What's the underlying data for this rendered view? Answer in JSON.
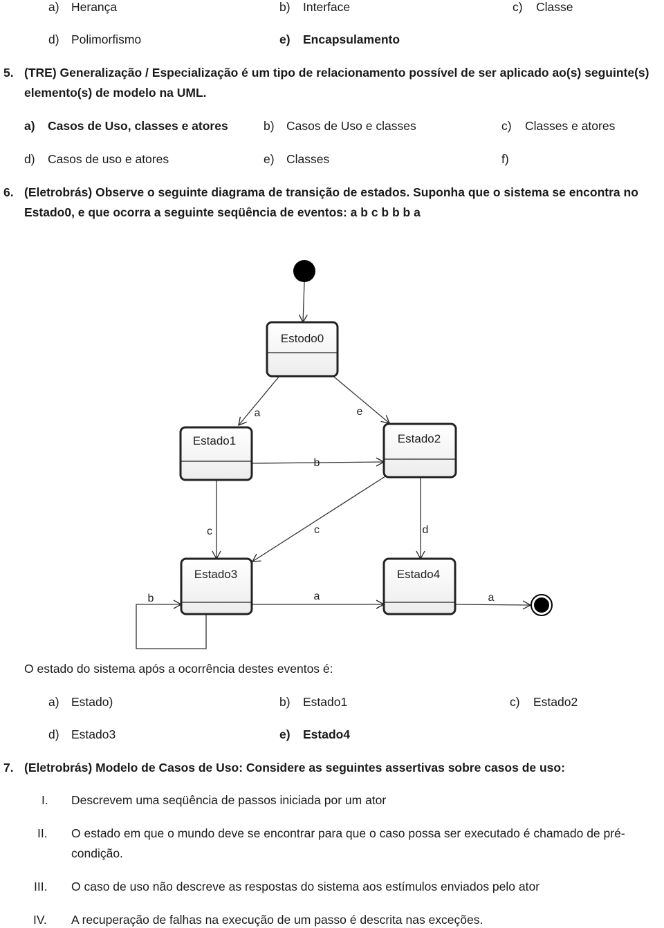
{
  "q4_options": [
    {
      "letter": "a)",
      "text": "Herança"
    },
    {
      "letter": "b)",
      "text": "Interface"
    },
    {
      "letter": "c)",
      "text": "Classe"
    },
    {
      "letter": "d)",
      "text": "Polimorfismo"
    },
    {
      "letter": "e)",
      "text": "Encapsulamento"
    }
  ],
  "q5": {
    "number": "5.",
    "line1": "(TRE) Generalização / Especialização é um tipo de relacionamento possível de ser aplicado ao(s) seguinte(s)",
    "line2": "elemento(s) de modelo na UML.",
    "options": [
      {
        "letter": "a)",
        "text": "Casos de Uso, classes e atores"
      },
      {
        "letter": "b)",
        "text": "Casos de Uso e classes"
      },
      {
        "letter": "c)",
        "text": "Classes e atores"
      },
      {
        "letter": "d)",
        "text": "Casos de uso e atores"
      },
      {
        "letter": "e)",
        "text": "Classes"
      },
      {
        "letter": "f)",
        "text": ""
      }
    ]
  },
  "q6": {
    "number": "6.",
    "line1": "(Eletrobrás) Observe o seguinte diagrama de transição de estados. Suponha que o sistema se encontra no",
    "line2": "Estado0, e que ocorra a seguinte seqüência de eventos: a b c b b b a",
    "diagram": {
      "states": [
        "Estodo0",
        "Estado1",
        "Estado2",
        "Estado3",
        "Estado4"
      ],
      "transitions": [
        {
          "from": "Estodo0",
          "to": "Estado1",
          "event": "a"
        },
        {
          "from": "Estodo0",
          "to": "Estado2",
          "event": "e"
        },
        {
          "from": "Estado1",
          "to": "Estado2",
          "event": "b"
        },
        {
          "from": "Estado1",
          "to": "Estado3",
          "event": "c"
        },
        {
          "from": "Estado2",
          "to": "Estado3",
          "event": "c"
        },
        {
          "from": "Estado2",
          "to": "Estado4",
          "event": "d"
        },
        {
          "from": "Estado3",
          "to": "Estado3",
          "event": "b"
        },
        {
          "from": "Estado3",
          "to": "Estado4",
          "event": "a"
        },
        {
          "from": "Estado4",
          "to": "final",
          "event": "a"
        }
      ]
    },
    "prompt": "O estado do sistema após a ocorrência destes eventos é:",
    "options": [
      {
        "letter": "a)",
        "text": "Estado)"
      },
      {
        "letter": "b)",
        "text": "Estado1"
      },
      {
        "letter": "c)",
        "text": "Estado2"
      },
      {
        "letter": "d)",
        "text": "Estado3"
      },
      {
        "letter": "e)",
        "text": "Estado4"
      }
    ]
  },
  "q7": {
    "number": "7.",
    "line1": "(Eletrobrás) Modelo de Casos de Uso: Considere as seguintes assertivas sobre casos de uso:",
    "items": [
      {
        "num": "I.",
        "text": "Descrevem uma seqüência de passos iniciada por um ator"
      },
      {
        "num": "II.",
        "text": "O estado em que o mundo deve se encontrar para que o caso possa ser executado é chamado de pré-",
        "text2": "condição."
      },
      {
        "num": "III.",
        "text": "O caso de uso não descreve as respostas do sistema aos estímulos enviados pelo ator"
      },
      {
        "num": "IV.",
        "text": "A recuperação de falhas na execução de um passo é descrita nas exceções."
      }
    ]
  }
}
